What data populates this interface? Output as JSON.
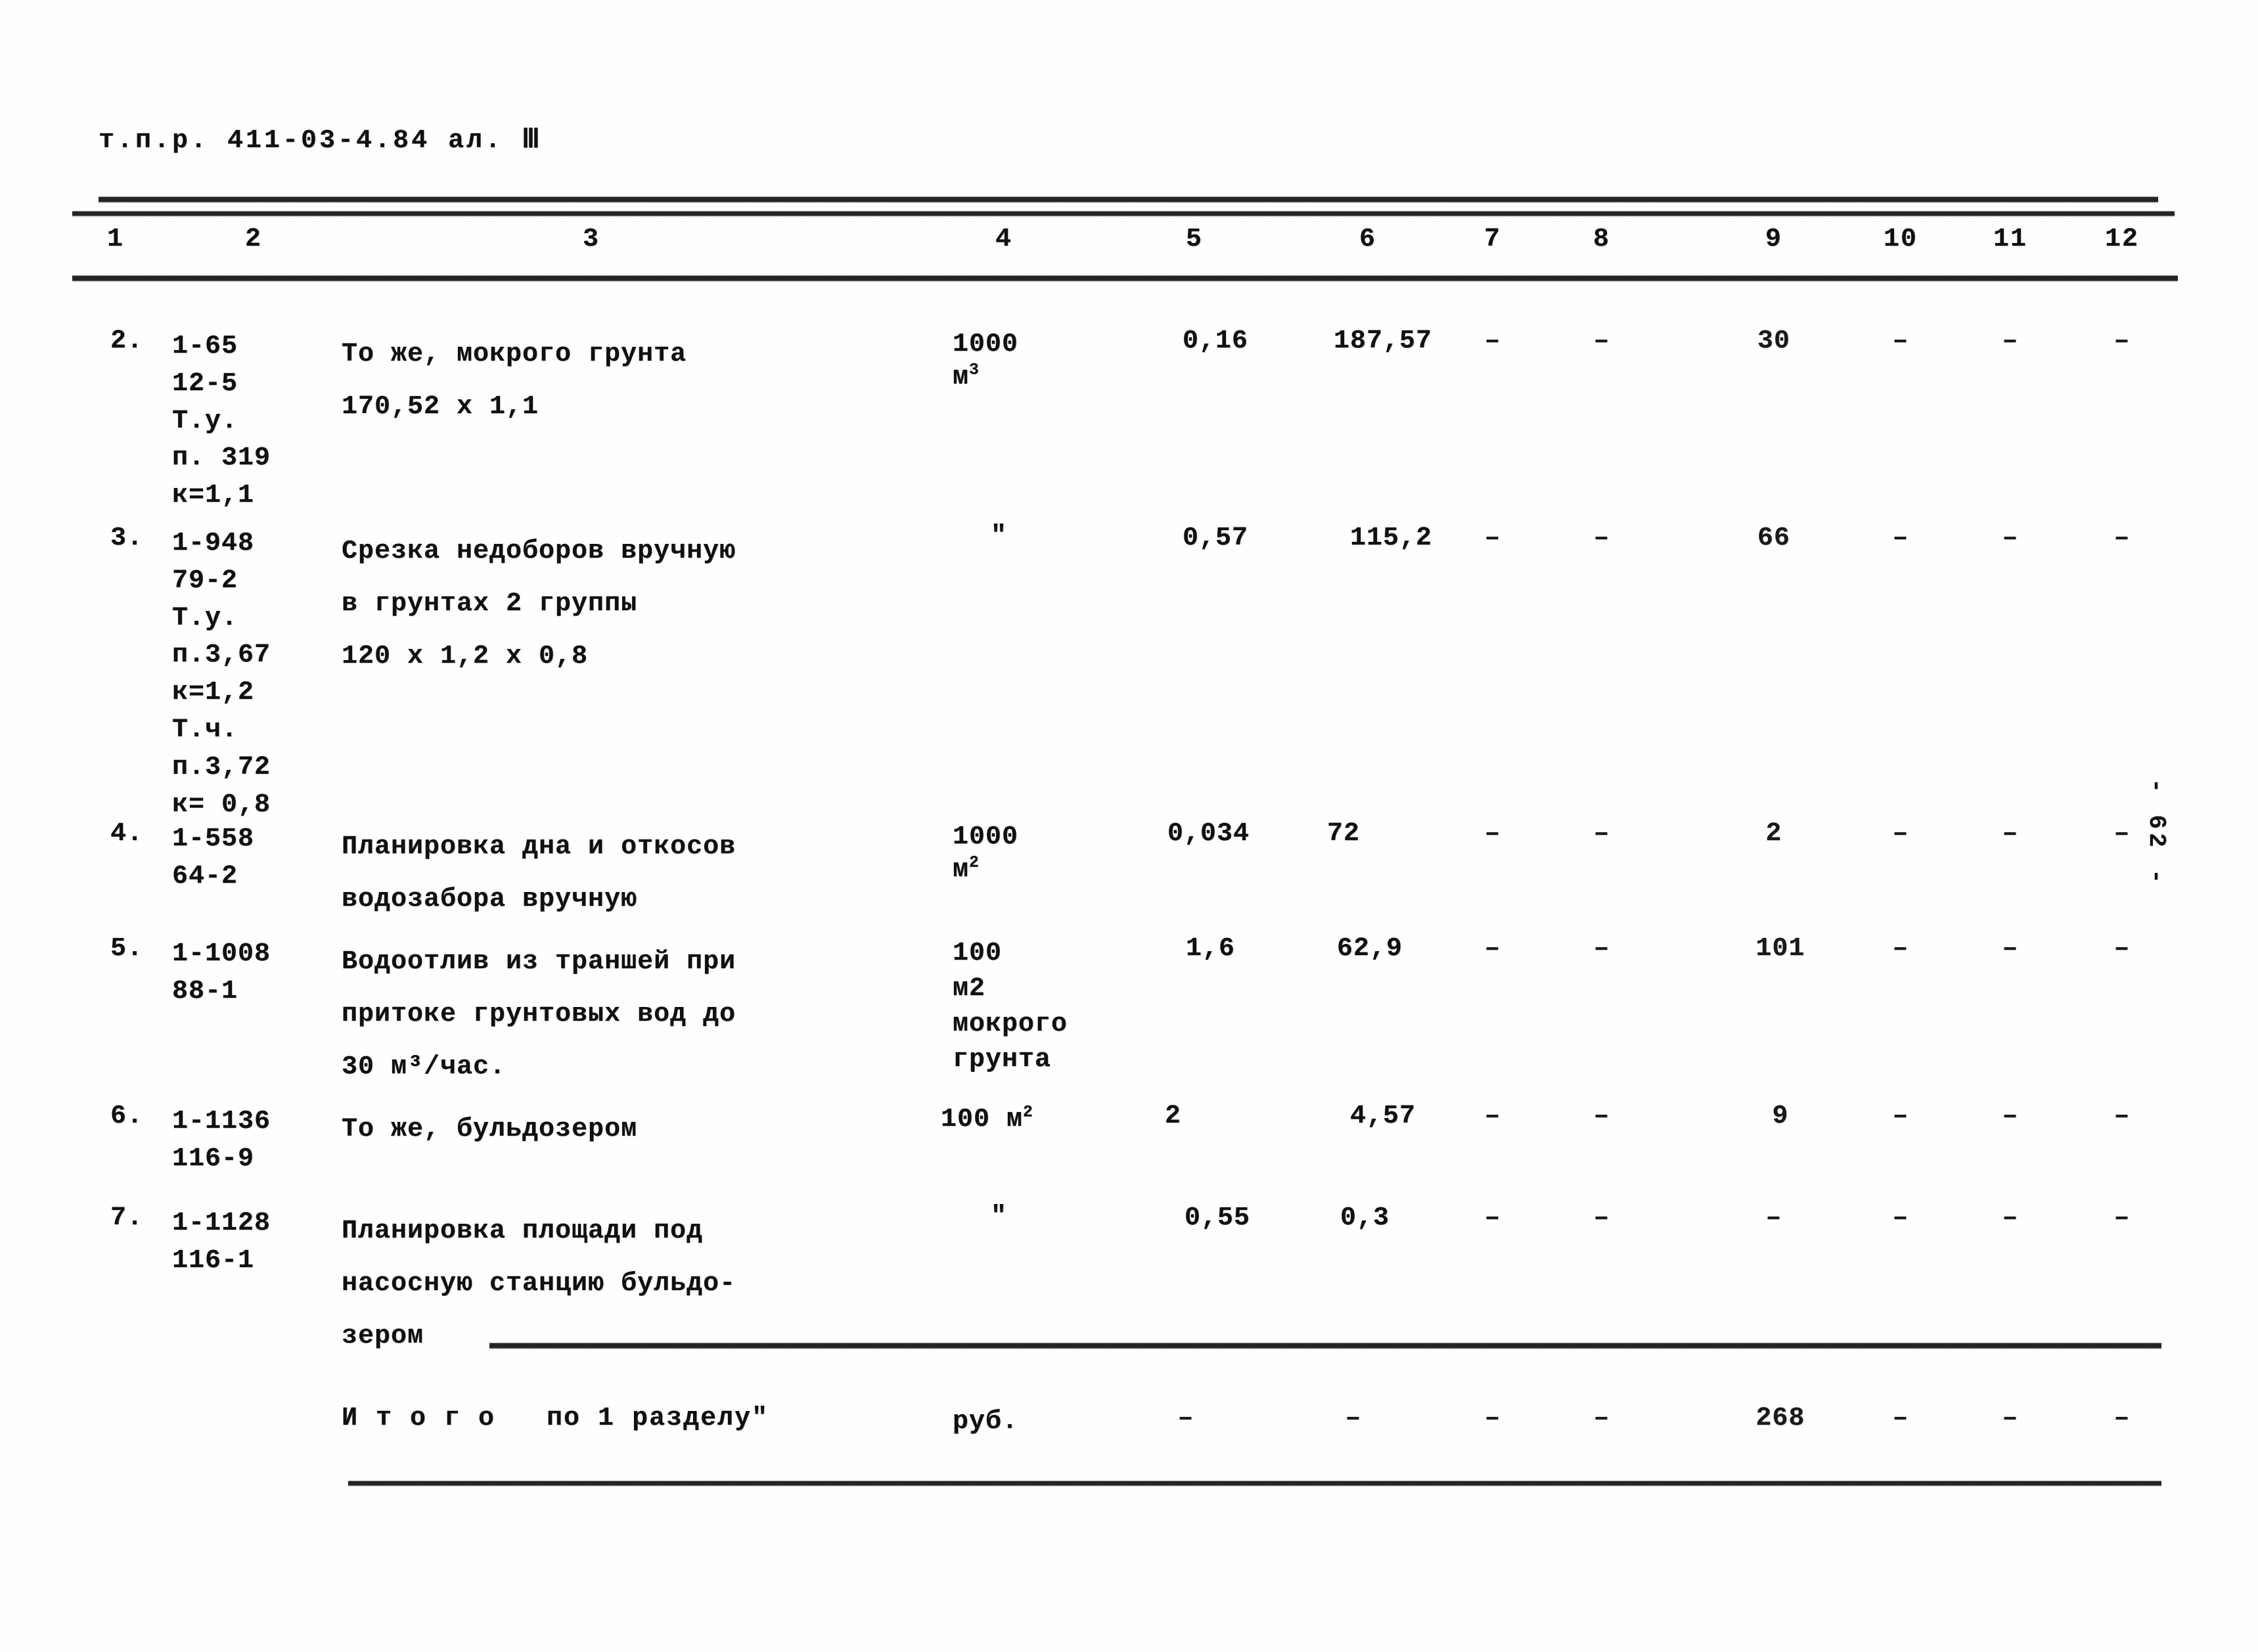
{
  "document": {
    "header_code": "т.п.р. 411-03-4.84 ал. Ⅲ",
    "page_number": "- 62 -"
  },
  "table": {
    "column_numbers": [
      "1",
      "2",
      "3",
      "4",
      "5",
      "6",
      "7",
      "8",
      "9",
      "10",
      "11",
      "12"
    ],
    "dash": "–",
    "rows": [
      {
        "num": "2.",
        "code_lines": [
          "1-65",
          "12-5",
          "Т.у.",
          "п. 319",
          "к=1,1"
        ],
        "desc_lines": [
          "То же, мокрого грунта",
          "170,52 х 1,1"
        ],
        "unit_lines": [
          "1000",
          "м"
        ],
        "unit_sup": "3",
        "col5": "0,16",
        "col6": "187,57",
        "col7": "–",
        "col8": "–",
        "col9": "30",
        "col10": "–",
        "col11": "–",
        "col12": "–"
      },
      {
        "num": "3.",
        "code_lines": [
          "1-948",
          "79-2",
          "Т.у.",
          "п.3,67",
          "к=1,2",
          "Т.ч.",
          "п.3,72",
          "к= 0,8"
        ],
        "desc_lines": [
          "Срезка недоборов вручную",
          "в грунтах 2 группы",
          "120 х 1,2 х 0,8"
        ],
        "unit_lines": [
          "\""
        ],
        "unit_sup": "",
        "col5": "0,57",
        "col6": "115,2",
        "col7": "–",
        "col8": "–",
        "col9": "66",
        "col10": "–",
        "col11": "–",
        "col12": "–"
      },
      {
        "num": "4.",
        "code_lines": [
          "1-558",
          "64-2"
        ],
        "desc_lines": [
          "Планировка дна и откосов",
          "водозабора вручную"
        ],
        "unit_lines": [
          "1000",
          "м"
        ],
        "unit_sup": "2",
        "col5": "0,034",
        "col6": "72",
        "col7": "–",
        "col8": "–",
        "col9": "2",
        "col10": "–",
        "col11": "–",
        "col12": "–"
      },
      {
        "num": "5.",
        "code_lines": [
          "1-1008",
          "88-1"
        ],
        "desc_lines": [
          "Водоотлив из траншей при",
          "притоке грунтовых вод до",
          "30 м³/час."
        ],
        "unit_lines": [
          "100",
          "м2",
          "мокрого",
          "грунта"
        ],
        "unit_sup": "",
        "col5": "1,6",
        "col6": "62,9",
        "col7": "–",
        "col8": "–",
        "col9": "101",
        "col10": "–",
        "col11": "–",
        "col12": "–"
      },
      {
        "num": "6.",
        "code_lines": [
          "1-1136",
          "116-9"
        ],
        "desc_lines": [
          "То же, бульдозером"
        ],
        "unit_lines": [
          "100 м"
        ],
        "unit_sup": "2",
        "col5": "2",
        "col6": "4,57",
        "col7": "–",
        "col8": "–",
        "col9": "9",
        "col10": "–",
        "col11": "–",
        "col12": "–"
      },
      {
        "num": "7.",
        "code_lines": [
          "1-1128",
          "116-1"
        ],
        "desc_lines": [
          "Планировка площади под",
          "насосную станцию бульдо-",
          "зером"
        ],
        "unit_lines": [
          "\""
        ],
        "unit_sup": "",
        "col5": "0,55",
        "col6": "0,3",
        "col7": "–",
        "col8": "–",
        "col9": "–",
        "col10": "–",
        "col11": "–",
        "col12": "–"
      }
    ],
    "total": {
      "label": "И т о г о   по 1 разделу\"",
      "unit": "руб.",
      "col5": "–",
      "col6": "–",
      "col7": "–",
      "col8": "–",
      "col9": "268",
      "col10": "–",
      "col11": "–",
      "col12": "–"
    }
  }
}
